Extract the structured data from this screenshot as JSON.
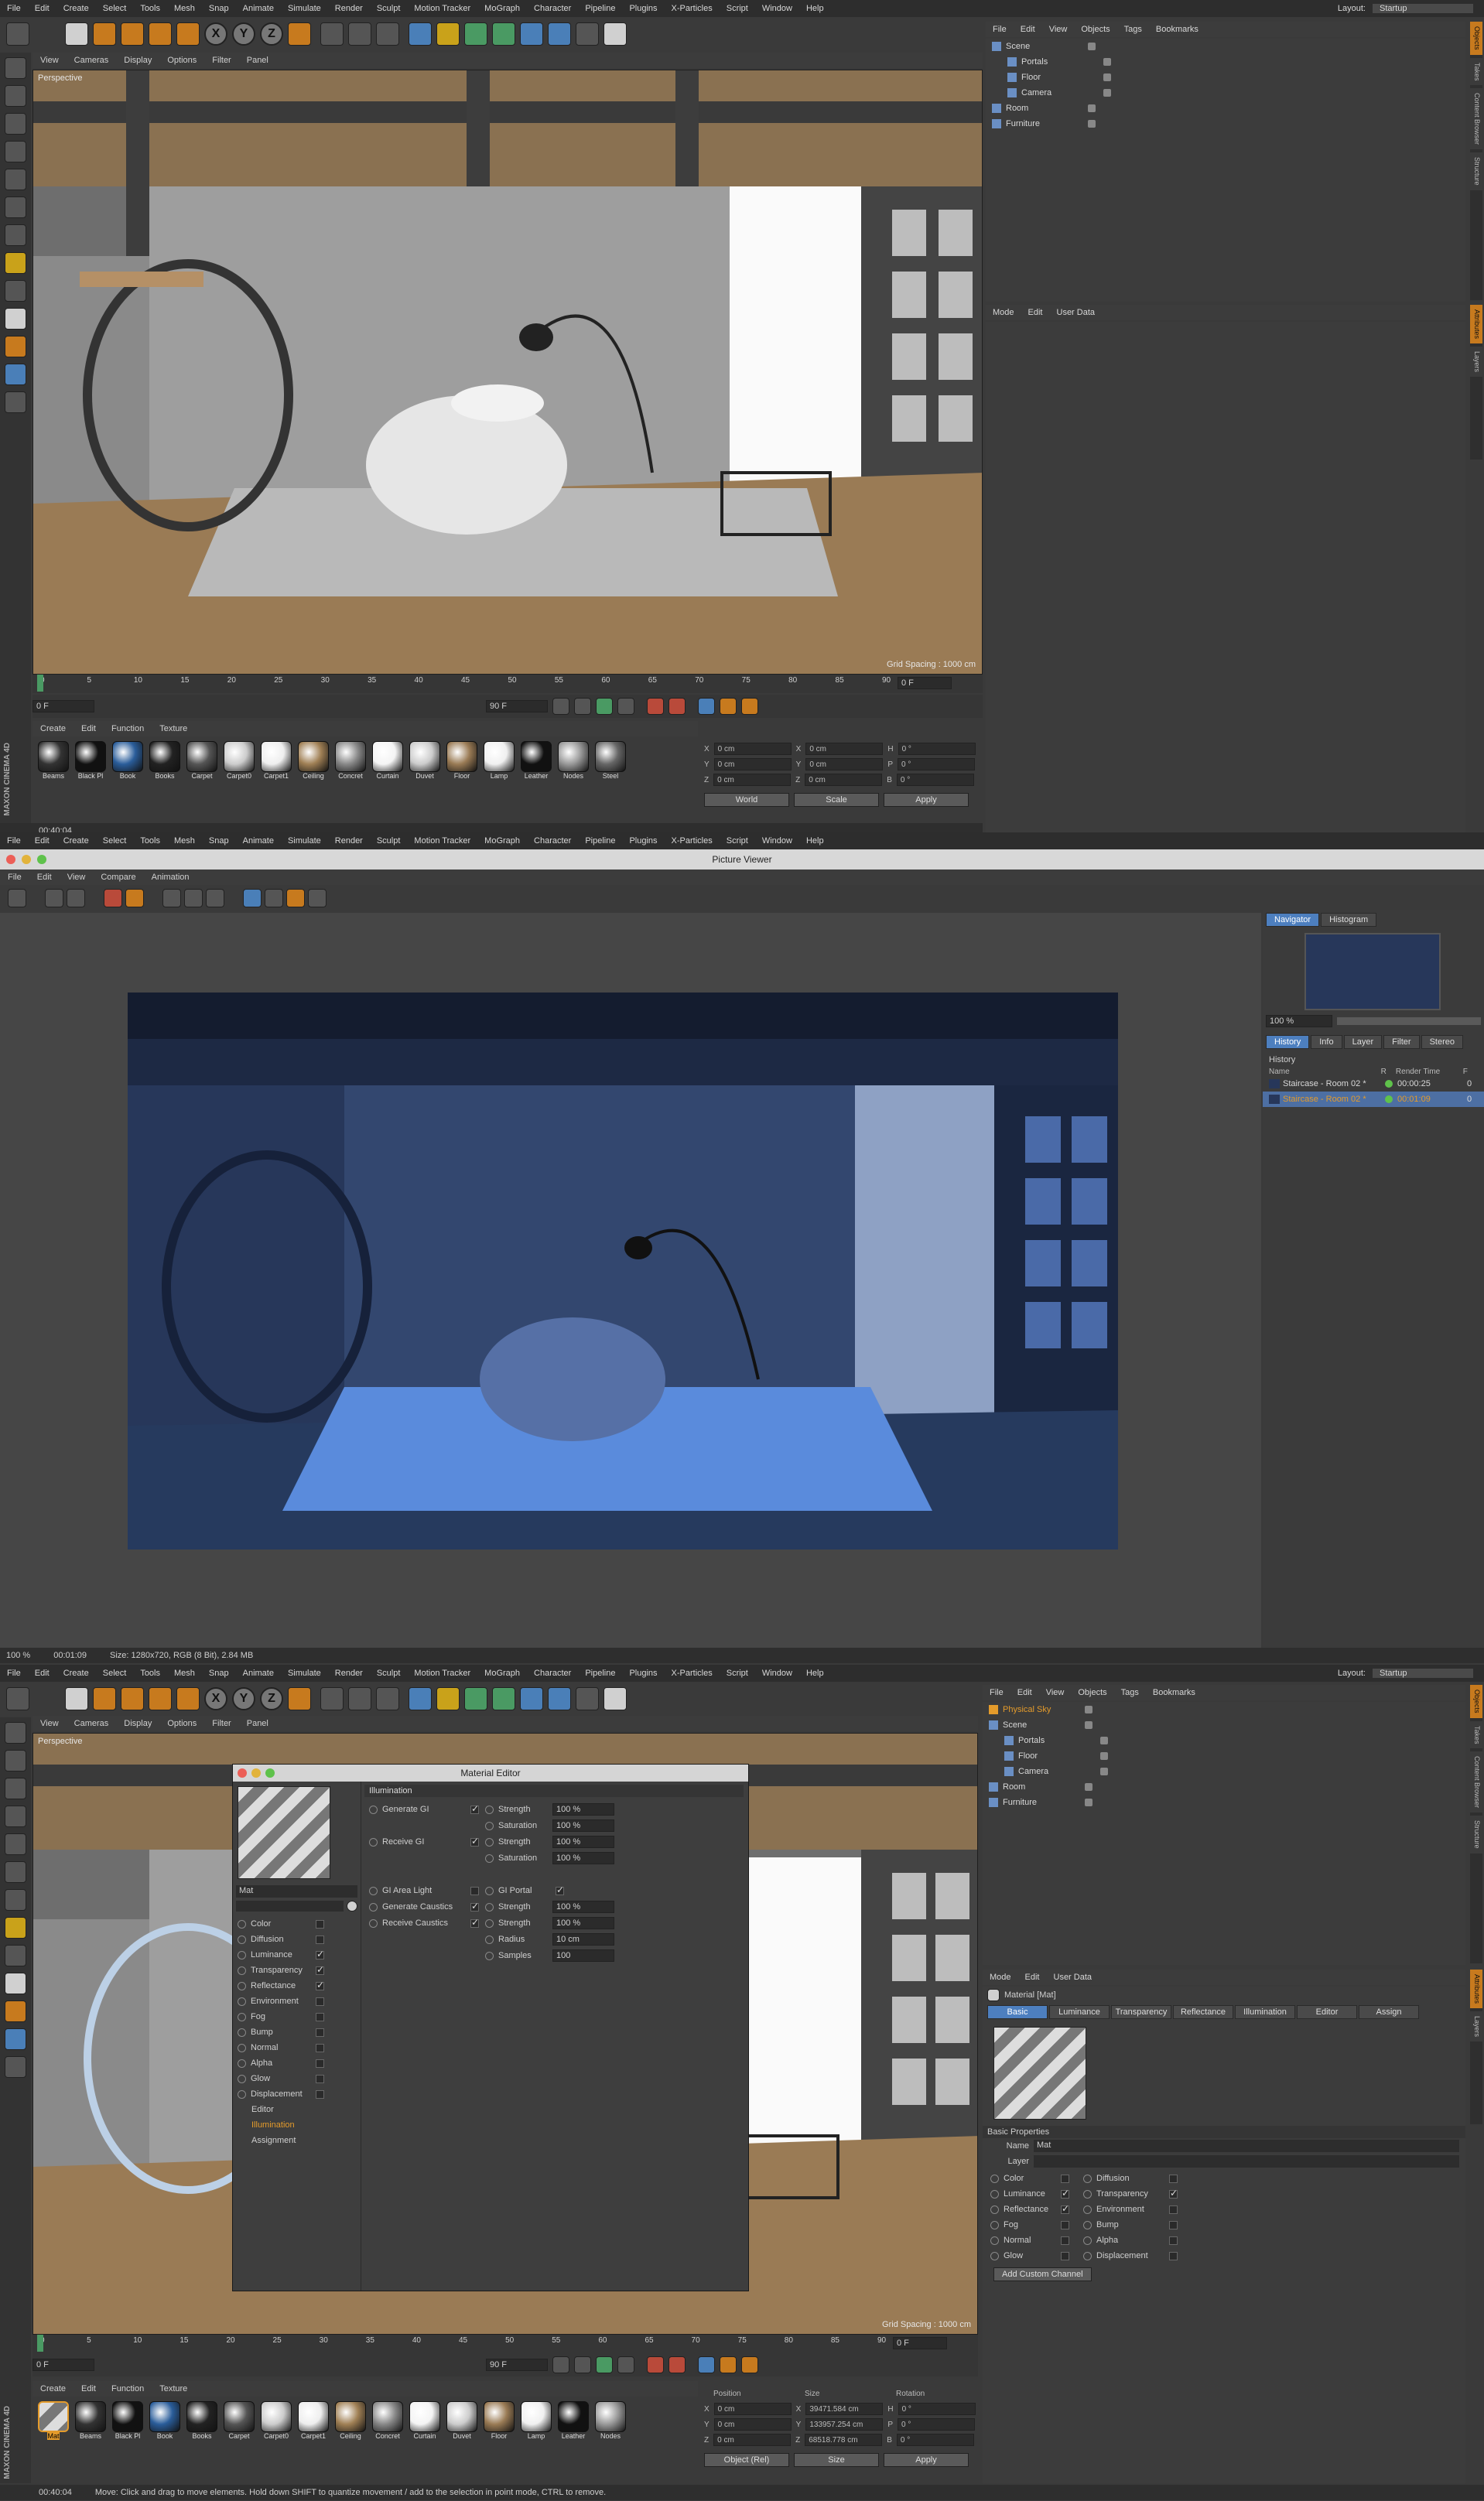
{
  "menus": [
    "File",
    "Edit",
    "Create",
    "Select",
    "Tools",
    "Mesh",
    "Snap",
    "Animate",
    "Simulate",
    "Render",
    "Sculpt",
    "Motion Tracker",
    "MoGraph",
    "Character",
    "Pipeline",
    "Plugins",
    "X-Particles",
    "Script",
    "Window",
    "Help"
  ],
  "layout_label": "Layout:",
  "layout_value": "Startup",
  "viewport_menus": [
    "View",
    "Cameras",
    "Display",
    "Options",
    "Filter",
    "Panel"
  ],
  "viewport_label": "Perspective",
  "grid_spacing": "Grid Spacing : 1000 cm",
  "obj_menus": [
    "File",
    "Edit",
    "View",
    "Objects",
    "Tags",
    "Bookmarks"
  ],
  "objects_top": [
    "Scene",
    "Portals",
    "Floor",
    "Camera",
    "Room",
    "Furniture"
  ],
  "objects_bottom": [
    "Physical Sky",
    "Scene",
    "Portals",
    "Floor",
    "Camera",
    "Room",
    "Furniture"
  ],
  "attr_menus": [
    "Mode",
    "Edit",
    "User Data"
  ],
  "side_tabs_top": [
    "Objects",
    "Takes",
    "Content Browser",
    "Structure"
  ],
  "side_tabs_mid": [
    "Attributes",
    "Layers"
  ],
  "timeline_ticks": [
    "0",
    "5",
    "10",
    "15",
    "20",
    "25",
    "30",
    "35",
    "40",
    "45",
    "50",
    "55",
    "60",
    "65",
    "70",
    "75",
    "80",
    "85",
    "90"
  ],
  "frame_start": "0 F",
  "frame_end": "90 F",
  "frame_cur": "0 F",
  "mat_menus": [
    "Create",
    "Edit",
    "Function",
    "Texture"
  ],
  "materials_top": [
    "Beams",
    "Black Pl",
    "Book",
    "Books",
    "Carpet",
    "Carpet0",
    "Carpet1",
    "Ceiling",
    "Concret",
    "Curtain",
    "Duvet",
    "Floor",
    "Lamp",
    "Leather",
    "Nodes",
    "Steel"
  ],
  "materials_bottom": [
    "Mat",
    "Beams",
    "Black Pl",
    "Book",
    "Books",
    "Carpet",
    "Carpet0",
    "Carpet1",
    "Ceiling",
    "Concret",
    "Curtain",
    "Duvet",
    "Floor",
    "Lamp",
    "Leather",
    "Nodes"
  ],
  "coords_top": {
    "rows": [
      [
        "X",
        "0 cm",
        "X",
        "0 cm",
        "H",
        "0 °"
      ],
      [
        "Y",
        "0 cm",
        "Y",
        "0 cm",
        "P",
        "0 °"
      ],
      [
        "Z",
        "0 cm",
        "Z",
        "0 cm",
        "B",
        "0 °"
      ]
    ],
    "mode1": "World",
    "mode2": "Scale",
    "apply": "Apply"
  },
  "coords_bottom": {
    "headers": [
      "Position",
      "Size",
      "Rotation"
    ],
    "rows": [
      [
        "X",
        "0 cm",
        "X",
        "39471.584 cm",
        "H",
        "0 °"
      ],
      [
        "Y",
        "0 cm",
        "Y",
        "133957.254 cm",
        "P",
        "0 °"
      ],
      [
        "Z",
        "0 cm",
        "Z",
        "68518.778 cm",
        "B",
        "0 °"
      ]
    ],
    "mode1": "Object (Rel)",
    "mode2": "Size",
    "apply": "Apply"
  },
  "status_top": "00:40:04",
  "status_bottom": "00:40:04",
  "status_bottom_msg": "Move: Click and drag to move elements. Hold down SHIFT to quantize movement / add to the selection in point mode, CTRL to remove.",
  "pv": {
    "title": "Picture Viewer",
    "menus": [
      "File",
      "Edit",
      "View",
      "Compare",
      "Animation"
    ],
    "tabs_top": [
      "Navigator",
      "Histogram"
    ],
    "zoom": "100 %",
    "tabs_hist": [
      "History",
      "Info",
      "Layer",
      "Filter",
      "Stereo"
    ],
    "history_label": "History",
    "cols": [
      "Name",
      "R",
      "Render Time",
      "F"
    ],
    "rows": [
      {
        "name": "Staircase - Room 02 *",
        "time": "00:00:25",
        "f": "0"
      },
      {
        "name": "Staircase - Room 02 *",
        "time": "00:01:09",
        "f": "0"
      }
    ],
    "status_zoom": "100 %",
    "status_time": "00:01:09",
    "status_size": "Size: 1280x720, RGB (8 Bit), 2.84 MB"
  },
  "me": {
    "title": "Material Editor",
    "name": "Mat",
    "channels": [
      {
        "label": "Color",
        "on": false
      },
      {
        "label": "Diffusion",
        "on": false
      },
      {
        "label": "Luminance",
        "on": true
      },
      {
        "label": "Transparency",
        "on": true
      },
      {
        "label": "Reflectance",
        "on": true
      },
      {
        "label": "Environment",
        "on": false
      },
      {
        "label": "Fog",
        "on": false
      },
      {
        "label": "Bump",
        "on": false
      },
      {
        "label": "Normal",
        "on": false
      },
      {
        "label": "Alpha",
        "on": false
      },
      {
        "label": "Glow",
        "on": false
      },
      {
        "label": "Displacement",
        "on": false
      }
    ],
    "extra": [
      "Editor",
      "Illumination",
      "Assignment"
    ],
    "section": "Illumination",
    "left_opts": [
      {
        "label": "Generate GI",
        "on": true,
        "row": 0
      },
      {
        "label": "Receive GI",
        "on": true,
        "row": 2
      },
      {
        "label": "GI Area Light",
        "on": false,
        "row": 5
      },
      {
        "label": "Generate Caustics",
        "on": true,
        "row": 6
      },
      {
        "label": "Receive Caustics",
        "on": true,
        "row": 7
      }
    ],
    "right_opts": [
      {
        "label": "Strength",
        "val": "100 %",
        "row": 0
      },
      {
        "label": "Saturation",
        "val": "100 %",
        "row": 1
      },
      {
        "label": "Strength",
        "val": "100 %",
        "row": 2
      },
      {
        "label": "Saturation",
        "val": "100 %",
        "row": 3
      },
      {
        "label": "GI Portal",
        "val": "",
        "row": 5
      },
      {
        "label": "Strength",
        "val": "100 %",
        "row": 6
      },
      {
        "label": "Strength",
        "val": "100 %",
        "row": 7
      },
      {
        "label": "Radius",
        "val": "10 cm",
        "row": 8
      },
      {
        "label": "Samples",
        "val": "100",
        "row": 9
      }
    ]
  },
  "attr": {
    "title": "Material [Mat]",
    "tabs": [
      "Basic",
      "Luminance",
      "Transparency",
      "Reflectance",
      "Illumination",
      "Editor",
      "Assign"
    ],
    "section": "Basic Properties",
    "name_label": "Name",
    "name_value": "Mat",
    "layer_label": "Layer",
    "left": [
      {
        "label": "Color",
        "on": false
      },
      {
        "label": "Luminance",
        "on": true
      },
      {
        "label": "Reflectance",
        "on": true
      },
      {
        "label": "Fog",
        "on": false
      },
      {
        "label": "Normal",
        "on": false
      },
      {
        "label": "Glow",
        "on": false
      }
    ],
    "right": [
      {
        "label": "Diffusion",
        "on": false
      },
      {
        "label": "Transparency",
        "on": true
      },
      {
        "label": "Environment",
        "on": false
      },
      {
        "label": "Bump",
        "on": false
      },
      {
        "label": "Alpha",
        "on": false
      },
      {
        "label": "Displacement",
        "on": false
      }
    ],
    "button": "Add Custom Channel"
  },
  "logo_text": "MAXON CINEMA 4D"
}
